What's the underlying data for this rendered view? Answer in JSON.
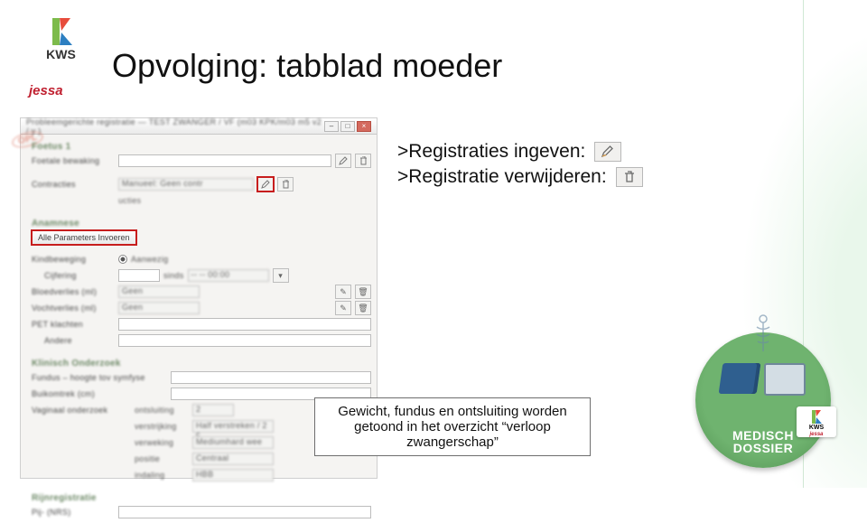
{
  "header": {
    "logo_label": "KWS",
    "sublogo_label": "jessa",
    "title": "Opvolging: tabblad moeder"
  },
  "appwin": {
    "titlebar": "Probleemgerichte registratie — TEST ZWANGER / VF  (m03 KPK/m03 m5 v2 / y )",
    "stamp": "OPL",
    "sections": {
      "foetus_title": "Foetus 1",
      "foetale_bewaking": "Foetale bewaking",
      "contracties": "Contracties",
      "contracties_val": "Manueel: Geen contr",
      "contracties_sub": "ucties",
      "anamnese_title": "Anamnese",
      "alle_params_btn": "Alle Parameters Invoeren",
      "kindbeweging": "Kindbeweging",
      "kindbeweging_opt": "Aanwezig",
      "cijfering": "Cijfering",
      "cijfering_sinds": "sinds",
      "cijfering_time": "-- --   00:00",
      "bloedverlies": "Bloedverlies (ml)",
      "bloedverlies_val": "Geen",
      "vochtverlies": "Vochtverlies (ml)",
      "vochtverlies_val": "Geen",
      "pet": "PET klachten",
      "andere": "Andere",
      "klinisch_title": "Klinisch Onderzoek",
      "fundus": "Fundus – hoogte tov symfyse",
      "buikomtrek": "Buikomtrek (cm)",
      "vaginaal": "Vaginaal onderzoek",
      "ontsluiting_lbl": "ontsluiting",
      "ontsluiting_val": "2",
      "verstrijking_lbl": "verstrijking",
      "verstrijking_val": "Half verstreken / 2 c",
      "verweking_lbl": "verweking",
      "verweking_val": "Mediumhard wee",
      "positie_lbl": "positie",
      "positie_val": "Centraal",
      "indaling_lbl": "indaling",
      "indaling_val": "HBB",
      "rijn_title": "Rijnregistratie",
      "pij": "Pij- (NRS)"
    }
  },
  "callouts": {
    "line1": ">Registraties ingeven:",
    "line2": ">Registratie verwijderen:"
  },
  "calloutBox": "Gewicht, fundus en ontsluiting worden getoond in het overzicht “verloop zwangerschap”",
  "badge": {
    "line1": "MEDISCH",
    "line2": "DOSSIER",
    "tag_label": "KWS"
  }
}
